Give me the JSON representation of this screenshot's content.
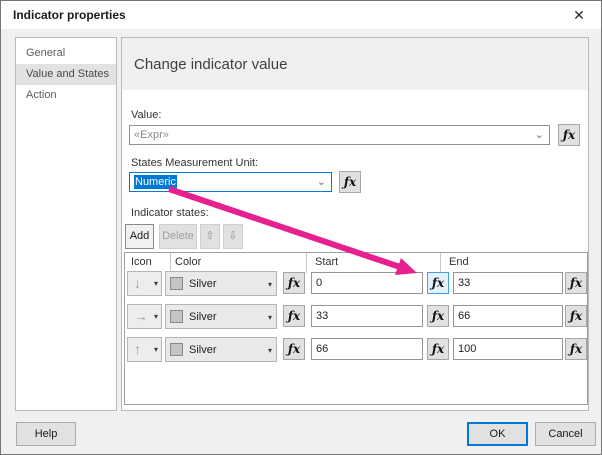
{
  "window": {
    "title": "Indicator properties"
  },
  "icons": {
    "close": "✕",
    "fx": "ƒx",
    "combo_chevron": "⌄",
    "caret": "▾",
    "move_up": "⇧",
    "move_down": "⇩"
  },
  "sidebar": {
    "items": [
      {
        "label": "General"
      },
      {
        "label": "Value and States"
      },
      {
        "label": "Action"
      }
    ]
  },
  "main": {
    "heading": "Change indicator value",
    "value_label": "Value:",
    "value": "«Expr»",
    "unit_label": "States Measurement Unit:",
    "unit_value": "Numeric",
    "states_label": "Indicator states:",
    "add_label": "Add",
    "delete_label": "Delete",
    "table": {
      "columns": [
        "Icon",
        "Color",
        "Start",
        "End"
      ],
      "rows": [
        {
          "icon": "↓",
          "color": "Silver",
          "start": "0",
          "end": "33"
        },
        {
          "icon": "→",
          "color": "Silver",
          "start": "33",
          "end": "66"
        },
        {
          "icon": "↑",
          "color": "Silver",
          "start": "66",
          "end": "100"
        }
      ]
    }
  },
  "footer": {
    "help": "Help",
    "ok": "OK",
    "cancel": "Cancel"
  },
  "colors": {
    "accent": "#0078d7",
    "annotation_arrow": "#e6218f",
    "silver_swatch": "#c0c0c0",
    "fx_highlight_border": "#42a0e0"
  }
}
